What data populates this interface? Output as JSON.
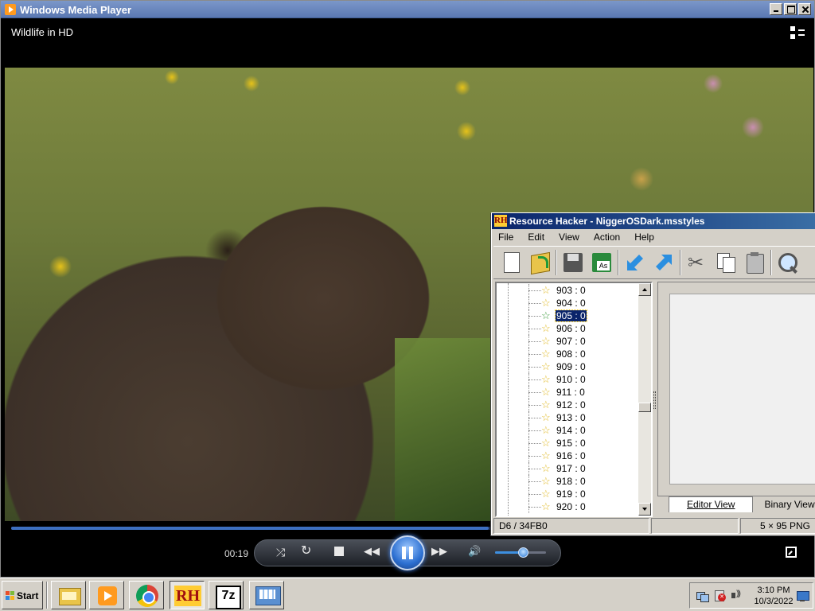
{
  "wmp": {
    "window_title": "Windows Media Player",
    "media_title": "Wildlife in HD",
    "elapsed_time": "00:19",
    "seek_progress": 0.6,
    "volume_level": 0.55
  },
  "resource_hacker": {
    "window_title": "Resource Hacker - NiggerOSDark.msstyles",
    "menu": [
      "File",
      "Edit",
      "View",
      "Action",
      "Help"
    ],
    "toolbar_icons": [
      "new-file-icon",
      "open-file-icon",
      "save-icon",
      "save-as-icon",
      "arrow-down-left-icon",
      "arrow-up-right-icon",
      "cut-icon",
      "copy-icon",
      "paste-icon",
      "find-icon"
    ],
    "tree_items": [
      {
        "label": "903 : 0",
        "selected": false
      },
      {
        "label": "904 : 0",
        "selected": false
      },
      {
        "label": "905 : 0",
        "selected": true
      },
      {
        "label": "906 : 0",
        "selected": false
      },
      {
        "label": "907 : 0",
        "selected": false
      },
      {
        "label": "908 : 0",
        "selected": false
      },
      {
        "label": "909 : 0",
        "selected": false
      },
      {
        "label": "910 : 0",
        "selected": false
      },
      {
        "label": "911 : 0",
        "selected": false
      },
      {
        "label": "912 : 0",
        "selected": false
      },
      {
        "label": "913 : 0",
        "selected": false
      },
      {
        "label": "914 : 0",
        "selected": false
      },
      {
        "label": "915 : 0",
        "selected": false
      },
      {
        "label": "916 : 0",
        "selected": false
      },
      {
        "label": "917 : 0",
        "selected": false
      },
      {
        "label": "918 : 0",
        "selected": false
      },
      {
        "label": "919 : 0",
        "selected": false
      },
      {
        "label": "920 : 0",
        "selected": false
      }
    ],
    "tabs": {
      "editor_view": "Editor View",
      "binary_view": "Binary View"
    },
    "status": {
      "offset": "D6 / 34FB0",
      "middle": "",
      "dimensions": "5 × 95  PNG"
    }
  },
  "taskbar": {
    "start_label": "Start",
    "tasks": [
      {
        "name": "task-explorer",
        "icon": "folder-icon",
        "active": false
      },
      {
        "name": "task-wmp",
        "icon": "media-player-icon",
        "active": false
      },
      {
        "name": "task-chrome",
        "icon": "chrome-icon",
        "active": false
      },
      {
        "name": "task-resource-hacker",
        "icon": "resource-hacker-icon",
        "active": true
      },
      {
        "name": "task-7zip",
        "icon": "7zip-icon",
        "active": false
      },
      {
        "name": "task-control-panel",
        "icon": "control-panel-icon",
        "active": false
      }
    ],
    "clock_time": "3:10 PM",
    "clock_date": "10/3/2022"
  }
}
